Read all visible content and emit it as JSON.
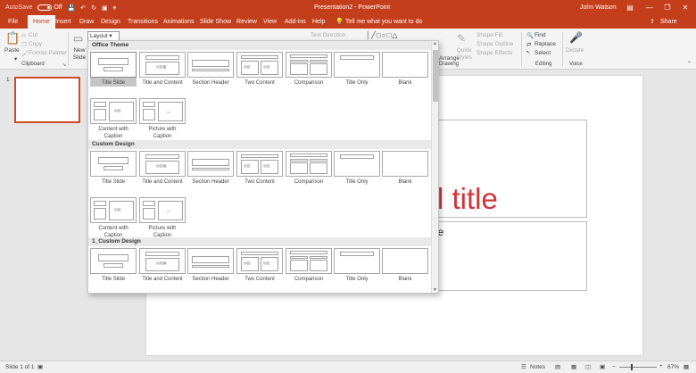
{
  "titlebar": {
    "autosave": "AutoSave",
    "autosave_state": "Off",
    "doc_title": "Presentation2 - PowerPoint",
    "user": "John Watson"
  },
  "tabs": [
    "File",
    "Home",
    "Insert",
    "Draw",
    "Design",
    "Transitions",
    "Animations",
    "Slide Show",
    "Review",
    "View",
    "Add-ins",
    "Help"
  ],
  "active_tab": "Home",
  "tell_me": "Tell me what you want to do",
  "share": "Share",
  "ribbon": {
    "paste": "Paste",
    "cut": "Cut",
    "copy": "Copy",
    "format_painter": "Format Painter",
    "clipboard": "Clipboard",
    "new_slide": "New Slide",
    "layout": "Layout",
    "text_direction": "Text Direction",
    "arrange": "Arrange",
    "quick_styles": "Quick Styles",
    "shape_fill": "Shape Fill",
    "shape_outline": "Shape Outline",
    "shape_effects": "Shape Effects",
    "drawing": "Drawing",
    "find": "Find",
    "replace": "Replace",
    "select": "Select",
    "editing": "Editing",
    "dictate": "Dictate",
    "voice": "Voice"
  },
  "gallery": {
    "sections": [
      {
        "title": "Office Theme",
        "rows": [
          [
            "Title Slide",
            "Title and Content",
            "Section Header",
            "Two Content",
            "Comparison",
            "Title Only",
            "Blank"
          ],
          [
            "Content with Caption",
            "Picture with Caption"
          ]
        ]
      },
      {
        "title": "Custom Design",
        "rows": [
          [
            "Title Slide",
            "Title and Content",
            "Section Header",
            "Two Content",
            "Comparison",
            "Title Only",
            "Blank"
          ],
          [
            "Content with Caption",
            "Picture with Caption"
          ]
        ]
      },
      {
        "title": "1_Custom Design",
        "rows": [
          [
            "Title Slide",
            "Title and Content",
            "Section Header",
            "Two Content",
            "Comparison",
            "Title Only",
            "Blank"
          ]
        ]
      }
    ]
  },
  "slide": {
    "thumb_number": "1",
    "title_fragment": "l title",
    "subtitle_fragment": "le"
  },
  "status": {
    "slide_info": "Slide 1 of 1",
    "notes": "Notes",
    "zoom": "67%"
  },
  "colors": {
    "accent": "#c43e1c",
    "title_red": "#d13438"
  }
}
